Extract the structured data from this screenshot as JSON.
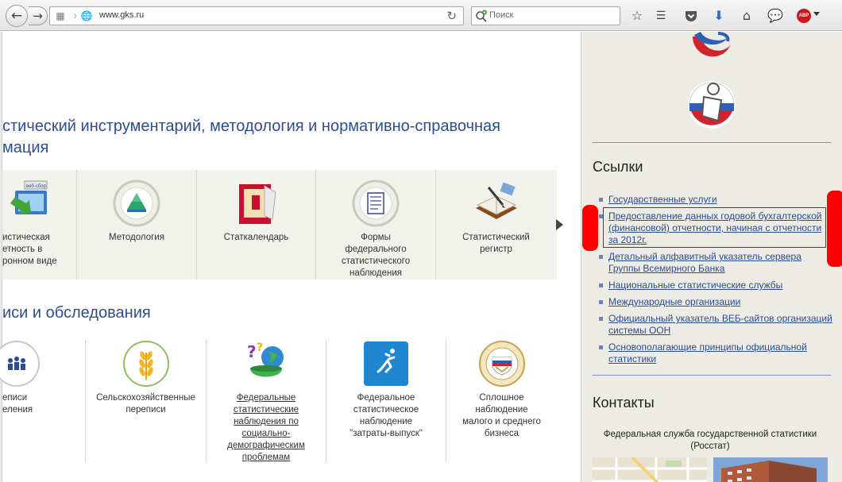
{
  "browser": {
    "url": "www.gks.ru",
    "search_placeholder": "Поиск",
    "abp_label": "ABP"
  },
  "main": {
    "section1_title": "стический инструментарий, методология и нормативно-справочная мация",
    "section1_title_line1": "стический инструментарий, методология и нормативно-справочная",
    "section1_title_line2": "мация",
    "tiles1": [
      {
        "label": "истическая етность в ронном виде",
        "line1": "истическая",
        "line2": "етность в",
        "line3": "ронном виде"
      },
      {
        "label": "Методология"
      },
      {
        "label": "Статкалендарь"
      },
      {
        "label": "Формы федерального статистического наблюдения",
        "line1": "Формы",
        "line2": "федерального",
        "line3": "статистического",
        "line4": "наблюдения"
      },
      {
        "label": "Статистический регистр",
        "line1": "Статистический",
        "line2": "регистр"
      }
    ],
    "section2_title": "иси и обследования",
    "tiles2": [
      {
        "line1": "еписи",
        "line2": "еления"
      },
      {
        "line1": "Сельскохозяйственные",
        "line2": "переписи"
      },
      {
        "line1": "Федеральные",
        "line2": "статистические",
        "line3": "наблюдения по",
        "line4": "социально-",
        "line5": "демографическим",
        "line6": "проблемам"
      },
      {
        "line1": "Федеральное",
        "line2": "статистическое",
        "line3": "наблюдение",
        "line4": "\"затраты-выпуск\""
      },
      {
        "line1": "Сплошное",
        "line2": "наблюдение",
        "line3": "малого и среднего",
        "line4": "бизнеса"
      }
    ]
  },
  "sidebar": {
    "links_title": "Ссылки",
    "links": [
      "Государственные услуги",
      "Предоставление данных годовой бухгалтерской (финансовой) отчетности, начиная с отчетности за 2012г.",
      "Детальный алфавитный указатель сервера Группы Всемирного Банка",
      "Национальные статистические службы",
      "Международные организации",
      "Официальный указатель ВЕБ-сайтов организаций системы ООН",
      "Основополагающие принципы официальной статистики"
    ],
    "contacts_title": "Контакты",
    "contacts_org": "Федеральная служба государственной статистики (Росстат)"
  },
  "colors": {
    "heading_blue": "#2f4c8f",
    "link_blue": "#2c4b97",
    "highlight_red": "#ff0000",
    "sidebar_bg": "#ecebe4"
  }
}
